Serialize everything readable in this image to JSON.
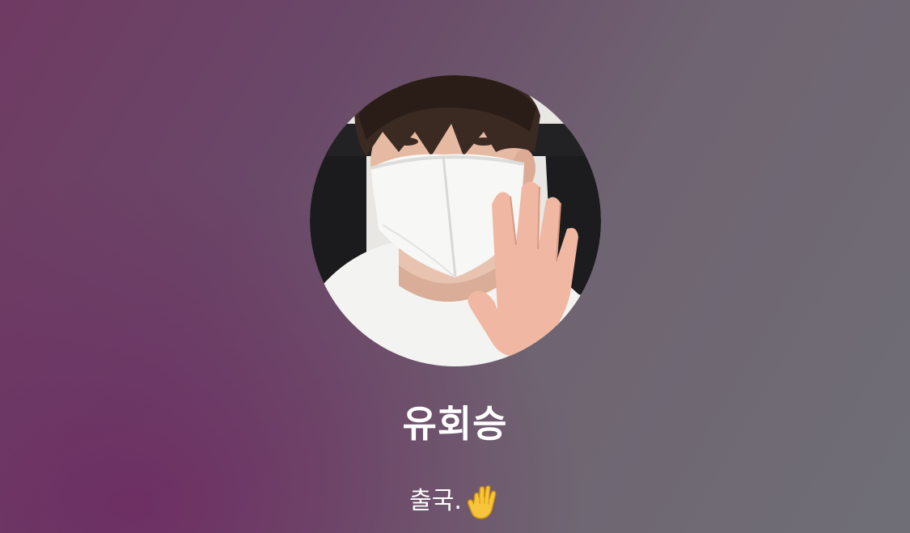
{
  "profile": {
    "name": "유회승",
    "status_message": "출국.",
    "status_emoji": "raised-hand-icon",
    "avatar": "profile-photo"
  },
  "colors": {
    "background_start": "#6f3a63",
    "background_end": "#6f6e76",
    "text": "#ffffff"
  }
}
